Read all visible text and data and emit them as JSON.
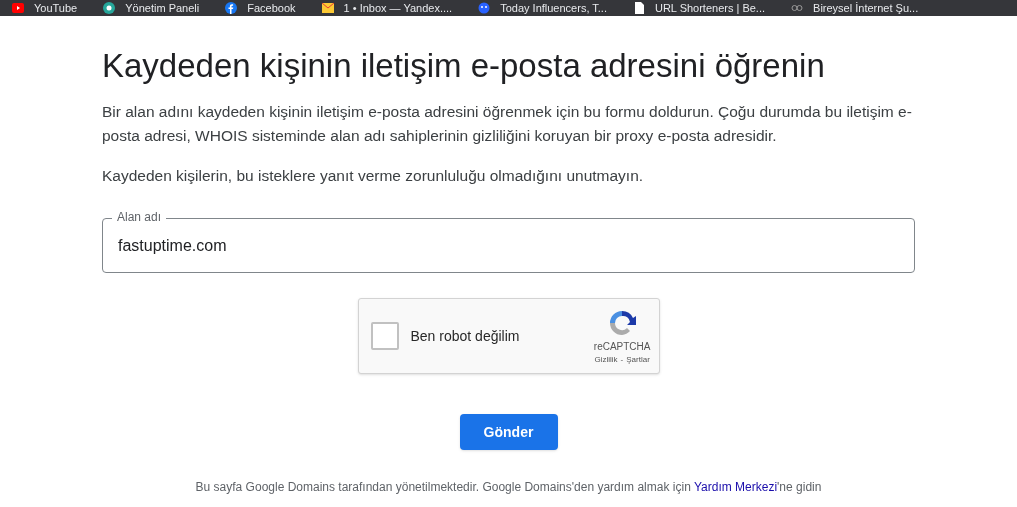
{
  "bookmarks": [
    {
      "label": "YouTube"
    },
    {
      "label": "Yönetim Paneli"
    },
    {
      "label": "Facebook"
    },
    {
      "label": "1 • Inbox — Yandex...."
    },
    {
      "label": "Today Influencers, T..."
    },
    {
      "label": "URL Shorteners | Be..."
    },
    {
      "label": "Bireysel İnternet Şu..."
    }
  ],
  "title": "Kaydeden kişinin iletişim e-posta adresini öğrenin",
  "paragraphs": [
    "Bir alan adını kaydeden kişinin iletişim e-posta adresini öğrenmek için bu formu doldurun. Çoğu durumda bu iletişim e-posta adresi, WHOIS sisteminde alan adı sahiplerinin gizliliğini koruyan bir proxy e-posta adresidir.",
    "Kaydeden kişilerin, bu isteklere yanıt verme zorunluluğu olmadığını unutmayın."
  ],
  "domain_field": {
    "label": "Alan adı",
    "value": "fastuptime.com"
  },
  "captcha": {
    "label": "Ben robot değilim",
    "checked": false,
    "brand": "reCAPTCHA",
    "links": [
      "Gizlilik",
      "Şartlar"
    ],
    "separator": "-"
  },
  "submit": "Gönder",
  "footer": {
    "text_before": "Bu sayfa Google Domains tarafından yönetilmektedir. Google Domains'den yardım almak için",
    "link": "Yardım Merkezi",
    "text_after": "'ne gidin"
  }
}
